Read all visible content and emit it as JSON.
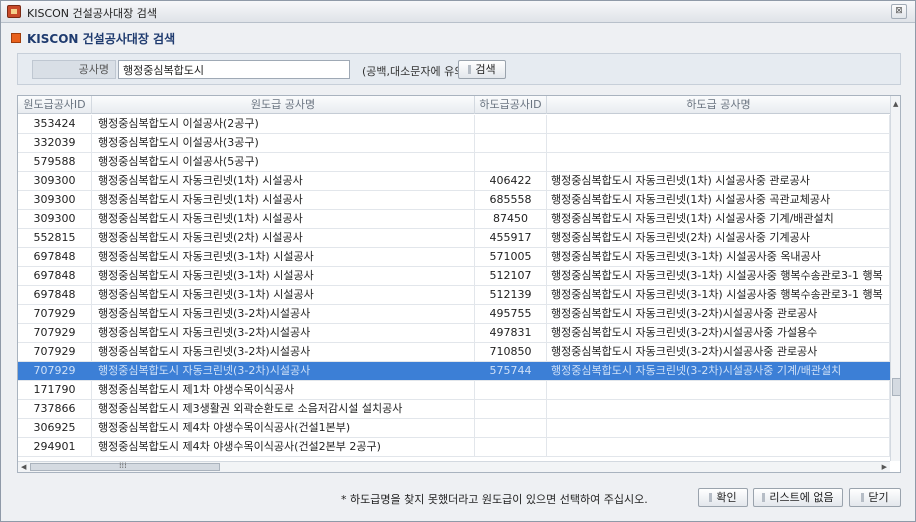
{
  "window": {
    "title": "KISCON 건설공사대장 검색",
    "close_glyph": "⊠"
  },
  "header": {
    "title": "KISCON 건설공사대장 검색"
  },
  "search": {
    "label": "공사명",
    "value": "행정중심복합도시",
    "hint": "(공백,대소문자에 유의)",
    "button_label": "검색"
  },
  "table": {
    "columns": [
      "원도급공사ID",
      "원도급 공사명",
      "하도급공사ID",
      "하도급 공사명"
    ],
    "selected_index": 13,
    "rows": [
      {
        "id": "353424",
        "name": "행정중심복합도시 이설공사(2공구)",
        "sub_id": "",
        "sub_name": ""
      },
      {
        "id": "332039",
        "name": "행정중심복합도시 이설공사(3공구)",
        "sub_id": "",
        "sub_name": ""
      },
      {
        "id": "579588",
        "name": "행정중심복합도시 이설공사(5공구)",
        "sub_id": "",
        "sub_name": ""
      },
      {
        "id": "309300",
        "name": "행정중심복합도시 자동크린넷(1차) 시설공사",
        "sub_id": "406422",
        "sub_name": "행정중심복합도시 자동크린넷(1차) 시설공사중 관로공사"
      },
      {
        "id": "309300",
        "name": "행정중심복합도시 자동크린넷(1차) 시설공사",
        "sub_id": "685558",
        "sub_name": "행정중심복합도시 자동크린넷(1차) 시설공사중 곡관교체공사"
      },
      {
        "id": "309300",
        "name": "행정중심복합도시 자동크린넷(1차) 시설공사",
        "sub_id": "87450",
        "sub_name": "행정중심복합도시 자동크린넷(1차) 시설공사중 기계/배관설치"
      },
      {
        "id": "552815",
        "name": "행정중심복합도시 자동크린넷(2차) 시설공사",
        "sub_id": "455917",
        "sub_name": "행정중심복합도시 자동크린넷(2차) 시설공사중 기계공사"
      },
      {
        "id": "697848",
        "name": "행정중심복합도시 자동크린넷(3-1차) 시설공사",
        "sub_id": "571005",
        "sub_name": "행정중심복합도시 자동크린넷(3-1차) 시설공사중 옥내공사"
      },
      {
        "id": "697848",
        "name": "행정중심복합도시 자동크린넷(3-1차) 시설공사",
        "sub_id": "512107",
        "sub_name": "행정중심복합도시 자동크린넷(3-1차) 시설공사중 행복수송관로3-1 행복"
      },
      {
        "id": "697848",
        "name": "행정중심복합도시 자동크린넷(3-1차) 시설공사",
        "sub_id": "512139",
        "sub_name": "행정중심복합도시 자동크린넷(3-1차) 시설공사중 행복수송관로3-1 행복"
      },
      {
        "id": "707929",
        "name": "행정중심복합도시 자동크린넷(3-2차)시설공사",
        "sub_id": "495755",
        "sub_name": "행정중심복합도시 자동크린넷(3-2차)시설공사중 관로공사"
      },
      {
        "id": "707929",
        "name": "행정중심복합도시 자동크린넷(3-2차)시설공사",
        "sub_id": "497831",
        "sub_name": "행정중심복합도시 자동크린넷(3-2차)시설공사중 가설용수"
      },
      {
        "id": "707929",
        "name": "행정중심복합도시 자동크린넷(3-2차)시설공사",
        "sub_id": "710850",
        "sub_name": "행정중심복합도시 자동크린넷(3-2차)시설공사중 관로공사"
      },
      {
        "id": "707929",
        "name": "행정중심복합도시 자동크린넷(3-2차)시설공사",
        "sub_id": "575744",
        "sub_name": "행정중심복합도시 자동크린넷(3-2차)시설공사중 기계/배관설치"
      },
      {
        "id": "171790",
        "name": "행정중심복합도시 제1차 야생수목이식공사",
        "sub_id": "",
        "sub_name": ""
      },
      {
        "id": "737866",
        "name": "행정중심복합도시 제3생활권 외곽순환도로 소음저감시설 설치공사",
        "sub_id": "",
        "sub_name": ""
      },
      {
        "id": "306925",
        "name": "행정중심복합도시 제4차 야생수목이식공사(건설1본부)",
        "sub_id": "",
        "sub_name": ""
      },
      {
        "id": "294901",
        "name": "행정중심복합도시 제4차 야생수목이식공사(건설2본부 2공구)",
        "sub_id": "",
        "sub_name": ""
      }
    ]
  },
  "footer": {
    "note": "* 하도급명을 찾지 못했더라고 원도급이 있으면 선택하여 주십시오.",
    "ok_label": "확인",
    "not_in_list_label": "리스트에 없음",
    "close_label": "닫기"
  },
  "colors": {
    "selection": "#3c7fd6",
    "header_title": "#1f3b6f",
    "accent_icon": "#e8601c"
  }
}
